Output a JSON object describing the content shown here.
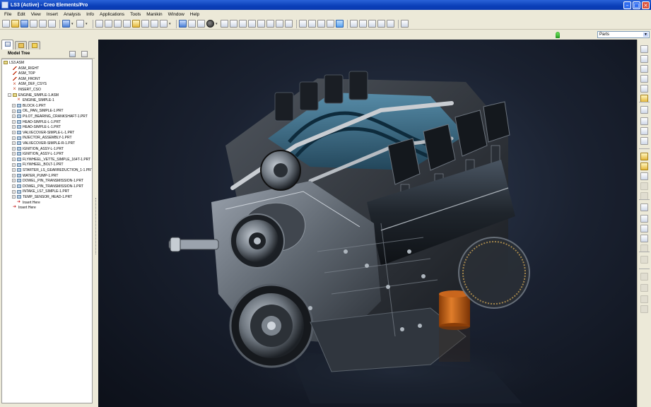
{
  "window": {
    "title": "LS3 (Active) - Creo Elements/Pro"
  },
  "menu": [
    "File",
    "Edit",
    "View",
    "Insert",
    "Analysis",
    "Info",
    "Applications",
    "Tools",
    "Manikin",
    "Window",
    "Help"
  ],
  "filter": {
    "selected": "Parts"
  },
  "navigator": {
    "header": "Model Tree",
    "items": [
      {
        "label": "LS3.ASM",
        "type": "asm",
        "indent": 0,
        "expand": ""
      },
      {
        "label": "ASM_RIGHT",
        "type": "datum",
        "indent": 1,
        "expand": ""
      },
      {
        "label": "ASM_TOP",
        "type": "datum",
        "indent": 1,
        "expand": ""
      },
      {
        "label": "ASM_FRONT",
        "type": "datum",
        "indent": 1,
        "expand": ""
      },
      {
        "label": "ASM_DEF_CSYS",
        "type": "csys",
        "indent": 1,
        "expand": ""
      },
      {
        "label": "INSERT_CSO",
        "type": "csys",
        "indent": 1,
        "expand": ""
      },
      {
        "label": "ENGINE_SIMPLE-1.ASM",
        "type": "asm",
        "indent": 1,
        "expand": "-"
      },
      {
        "label": "ENGINE_SIMPLE-1",
        "type": "csys",
        "indent": 2,
        "expand": ""
      },
      {
        "label": "BLOCK-1.PRT",
        "type": "part",
        "indent": 2,
        "expand": "+"
      },
      {
        "label": "OIL_PAN_SIMPLE-1.PRT",
        "type": "part",
        "indent": 2,
        "expand": "+"
      },
      {
        "label": "PILOT_BEARING_CRANKSHAFT-1.PRT",
        "type": "part",
        "indent": 2,
        "expand": "+"
      },
      {
        "label": "HEAD-SIMPLE-L-1.PRT",
        "type": "part",
        "indent": 2,
        "expand": "+"
      },
      {
        "label": "HEAD-SIMPLE-L-1.PRT",
        "type": "part",
        "indent": 2,
        "expand": "+"
      },
      {
        "label": "VALVECOVER-SIMPLE-L-1.PRT",
        "type": "part",
        "indent": 2,
        "expand": "+"
      },
      {
        "label": "INJECTOR_ASSEMBLY-1.PRT",
        "type": "part",
        "indent": 2,
        "expand": "+"
      },
      {
        "label": "VALVECOVER-SIMPLE-R-1.PRT",
        "type": "part",
        "indent": 2,
        "expand": "+"
      },
      {
        "label": "IGNITION_ASSY-L-1.PRT",
        "type": "part",
        "indent": 2,
        "expand": "+"
      },
      {
        "label": "IGNITION_ASSY-L-1.PRT",
        "type": "part",
        "indent": 2,
        "expand": "+"
      },
      {
        "label": "FLYWHEEL_VETTE_SIMPLE_164T-1.PRT",
        "type": "part",
        "indent": 2,
        "expand": "+"
      },
      {
        "label": "FLYWHEEL_BOLT-1.PRT",
        "type": "part",
        "indent": 2,
        "expand": "+"
      },
      {
        "label": "STARTER_LS_GEARREDUCTION_1-1.PRT",
        "type": "part",
        "indent": 2,
        "expand": "+"
      },
      {
        "label": "WATER_PUMP-1.PRT",
        "type": "part",
        "indent": 2,
        "expand": "+"
      },
      {
        "label": "DOWEL_PIN_TRANSMISSION-1.PRT",
        "type": "part",
        "indent": 2,
        "expand": "+"
      },
      {
        "label": "DOWEL_PIN_TRANSMISSION-1.PRT",
        "type": "part",
        "indent": 2,
        "expand": "+"
      },
      {
        "label": "INTAKE_LS7_SIMPLE-1.PRT",
        "type": "part",
        "indent": 2,
        "expand": "+"
      },
      {
        "label": "TEMP_SENSOR_HEAD-1.PRT",
        "type": "part",
        "indent": 2,
        "expand": "+"
      },
      {
        "label": "Insert Here",
        "type": "insert",
        "indent": 2,
        "expand": ""
      },
      {
        "label": "Insert Here",
        "type": "insert",
        "indent": 1,
        "expand": ""
      }
    ]
  },
  "colors": {
    "title_bar": "#0a3fb8",
    "background": "#151b27",
    "accent": "#d6661c"
  },
  "icons": {
    "toolbar": [
      "new-icon",
      "open-icon",
      "save-icon",
      "print-icon",
      "email-icon",
      "undo-icon",
      "redo-icon",
      "cut-icon",
      "copy-icon",
      "paste-icon",
      "paste-special-icon",
      "regenerate-icon",
      "find-icon",
      "select-icon",
      "view-icon",
      "repaint-icon",
      "zoom-in-icon",
      "zoom-out-icon",
      "refit-icon",
      "orient-icon",
      "saved-views-icon",
      "layers-icon",
      "wireframe-icon",
      "hidden-line-icon",
      "no-hidden-icon",
      "shading-icon",
      "enhanced-realism-icon",
      "datum-planes-icon",
      "datum-axes-icon",
      "datum-points-icon",
      "csys-icon",
      "annotations-icon",
      "context-help-icon"
    ],
    "right": [
      "sketch-icon",
      "plane-icon",
      "axis-icon",
      "curve-icon",
      "point-icon",
      "csys-icon",
      "analysis-icon",
      "copy-geometry-icon",
      "publish-geometry-icon",
      "shrinkwrap-icon",
      "component-icon",
      "create-component-icon",
      "repeat-icon",
      "mirror-icon",
      "pattern-icon",
      "explode-icon",
      "hole-icon",
      "round-icon",
      "chamfer-icon",
      "sweep-icon",
      "extrude-icon",
      "revolve-icon",
      "blend-icon",
      "draft-icon",
      "shell-icon"
    ]
  }
}
